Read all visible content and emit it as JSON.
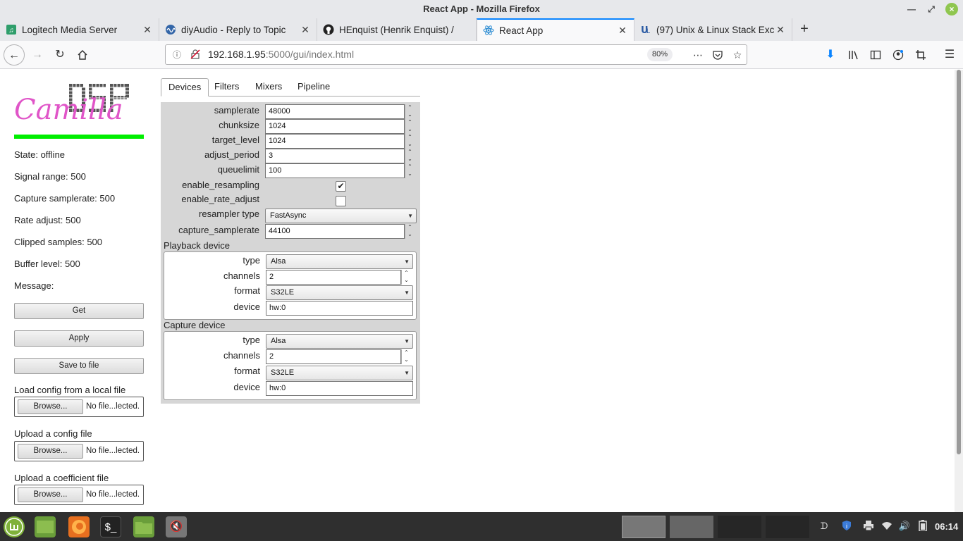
{
  "window": {
    "title": "React App - Mozilla Firefox"
  },
  "browser": {
    "tabs": [
      {
        "title": "Logitech Media Server",
        "icon": "music-icon"
      },
      {
        "title": "diyAudio - Reply to Topic",
        "icon": "diyaudio-icon"
      },
      {
        "title": "HEnquist (Henrik Enquist) / ",
        "icon": "github-icon"
      },
      {
        "title": "React App",
        "icon": "react-icon"
      },
      {
        "title": "(97) Unix & Linux Stack Exch",
        "icon": "unix-icon"
      }
    ],
    "url_host": "192.168.1.95",
    "url_rest": ":5000/gui/index.html",
    "zoom": "80%"
  },
  "sidebar": {
    "logo_text_script": "Camilla",
    "logo_text_block": "DSP",
    "stats": [
      "State: offline",
      "Signal range: 500",
      "Capture samplerate: 500",
      "Rate adjust: 500",
      "Clipped samples: 500",
      "Buffer level: 500",
      "Message:"
    ],
    "buttons": {
      "get": "Get",
      "apply": "Apply",
      "save": "Save to file"
    },
    "files": [
      {
        "label": "Load config from a local file",
        "browse": "Browse...",
        "status": "No file...lected."
      },
      {
        "label": "Upload a config file",
        "browse": "Browse...",
        "status": "No file...lected."
      },
      {
        "label": "Upload a coefficient file",
        "browse": "Browse...",
        "status": "No file...lected."
      }
    ]
  },
  "main": {
    "tabs": [
      "Devices",
      "Filters",
      "Mixers",
      "Pipeline"
    ],
    "devices": {
      "samplerate": {
        "label": "samplerate",
        "value": "48000"
      },
      "chunksize": {
        "label": "chunksize",
        "value": "1024"
      },
      "target_level": {
        "label": "target_level",
        "value": "1024"
      },
      "adjust_period": {
        "label": "adjust_period",
        "value": "3"
      },
      "queuelimit": {
        "label": "queuelimit",
        "value": "100"
      },
      "enable_resampling": {
        "label": "enable_resampling",
        "checked": true
      },
      "enable_rate_adjust": {
        "label": "enable_rate_adjust",
        "checked": false
      },
      "resampler_type": {
        "label": "resampler type",
        "value": "FastAsync"
      },
      "capture_samplerate": {
        "label": "capture_samplerate",
        "value": "44100"
      }
    },
    "playback": {
      "title": "Playback device",
      "type": {
        "label": "type",
        "value": "Alsa"
      },
      "channels": {
        "label": "channels",
        "value": "2"
      },
      "format": {
        "label": "format",
        "value": "S32LE"
      },
      "device": {
        "label": "device",
        "value": "hw:0"
      }
    },
    "capture": {
      "title": "Capture device",
      "type": {
        "label": "type",
        "value": "Alsa"
      },
      "channels": {
        "label": "channels",
        "value": "2"
      },
      "format": {
        "label": "format",
        "value": "S32LE"
      },
      "device": {
        "label": "device",
        "value": "hw:0"
      }
    }
  },
  "taskbar": {
    "clock": "06:14"
  },
  "colors": {
    "accent": "#0a84ff",
    "status_bar": "#00ee00",
    "logo_pink": "#e055c8"
  }
}
